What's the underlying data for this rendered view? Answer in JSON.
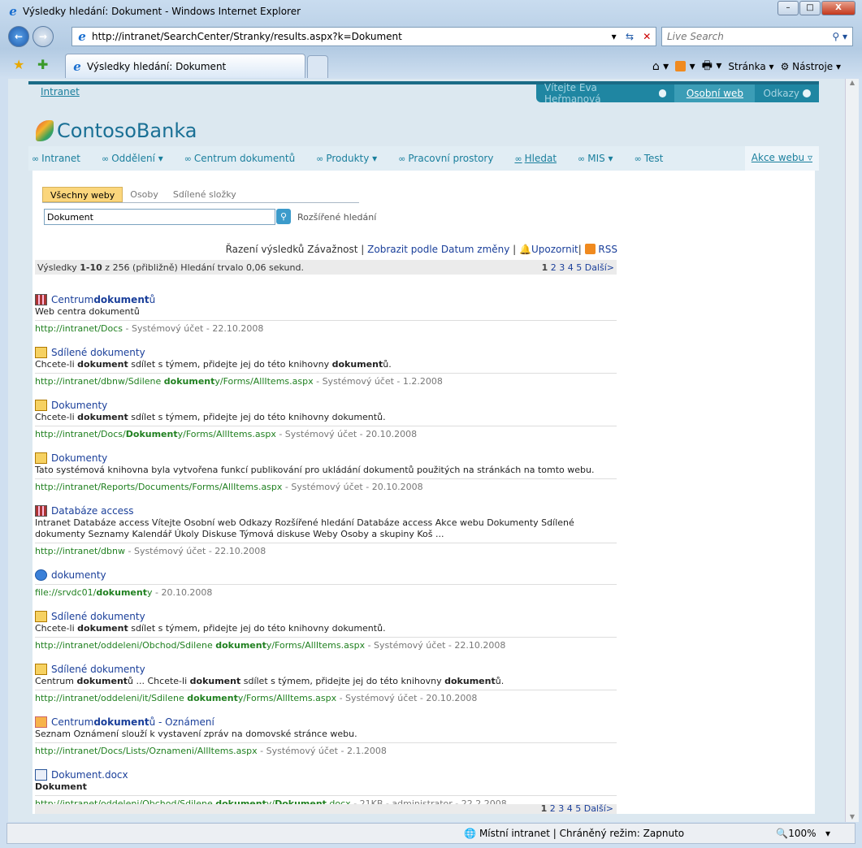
{
  "window": {
    "title": "Výsledky hledání: Dokument - Windows Internet Explorer",
    "minimize": "–",
    "maximize": "□",
    "close": "X"
  },
  "browser": {
    "url": "http://intranet/SearchCenter/Stranky/results.aspx?k=Dokument",
    "search_placeholder": "Live Search",
    "tab_title": "Výsledky hledání: Dokument",
    "page_menu": "Stránka",
    "tools_menu": "Nástroje"
  },
  "status": {
    "zone": "Místní intranet | Chráněný režim: Zapnuto",
    "zoom": "100%"
  },
  "site": {
    "breadcrumb": "Intranet",
    "welcome": "Vítejte Eva Heřmanová",
    "my_site": "Osobní web",
    "links": "Odkazy",
    "logo": "ContosoBanka",
    "nav": [
      "Intranet",
      "Oddělení ▾",
      "Centrum dokumentů",
      "Produkty ▾",
      "Pracovní prostory",
      "Hledat",
      "MIS ▾",
      "Test"
    ],
    "site_actions": "Akce webu ▿"
  },
  "search": {
    "scopes": [
      "Všechny weby",
      "Osoby",
      "Sdílené složky"
    ],
    "query": "Dokument",
    "advanced": "Rozšířené hledání",
    "sort_label": "Řazení výsledků",
    "sort_value": "Závažnost",
    "view_by": "Zobrazit podle Datum změny",
    "alert": "Upozornit",
    "rss": "RSS",
    "summary_pre": "Výsledky ",
    "summary_range": "1-10",
    "summary_post": " z 256 (přibližně) Hledání trvalo 0,06 sekund.",
    "pages": [
      "1",
      "2",
      "3",
      "4",
      "5"
    ],
    "next": "Další>"
  },
  "results": [
    {
      "icon": "site",
      "title": [
        [
          "Centrum ",
          0
        ],
        [
          "dokument",
          1
        ],
        [
          "ů",
          0
        ]
      ],
      "desc": [
        [
          "Web centra dokumentů",
          0
        ]
      ],
      "url": [
        [
          "http://intranet/Docs",
          0
        ]
      ],
      "meta": " - Systémový účet - 22.10.2008"
    },
    {
      "icon": "doclib",
      "title": [
        [
          "Sdílené dokumenty",
          0
        ]
      ],
      "desc": [
        [
          "Chcete-li ",
          0
        ],
        [
          "dokument",
          1
        ],
        [
          " sdílet s týmem, přidejte jej do této knihovny ",
          0
        ],
        [
          "dokument",
          1
        ],
        [
          "ů.",
          0
        ]
      ],
      "url": [
        [
          "http://intranet/dbnw/Sdilene ",
          0
        ],
        [
          "dokument",
          1
        ],
        [
          "y/Forms/AllItems.aspx",
          0
        ]
      ],
      "meta": " - Systémový účet - 1.2.2008"
    },
    {
      "icon": "doclib",
      "title": [
        [
          "Dokumenty",
          0
        ]
      ],
      "desc": [
        [
          "Chcete-li ",
          0
        ],
        [
          "dokument",
          1
        ],
        [
          " sdílet s týmem, přidejte jej do této knihovny dokumentů.",
          0
        ]
      ],
      "url": [
        [
          "http://intranet/Docs/",
          0
        ],
        [
          "Dokument",
          1
        ],
        [
          "y/Forms/AllItems.aspx",
          0
        ]
      ],
      "meta": " - Systémový účet - 20.10.2008"
    },
    {
      "icon": "doclib",
      "title": [
        [
          "Dokumenty",
          0
        ]
      ],
      "desc": [
        [
          "Tato systémová knihovna byla vytvořena funkcí publikování pro ukládání dokumentů použitých na stránkách na tomto webu.",
          0
        ]
      ],
      "url": [
        [
          "http://intranet/Reports/Documents/Forms/AllItems.aspx",
          0
        ]
      ],
      "meta": " - Systémový účet - 20.10.2008"
    },
    {
      "icon": "site",
      "title": [
        [
          "Databáze access",
          0
        ]
      ],
      "desc": [
        [
          "Intranet Databáze access Vítejte Osobní web Odkazy Rozšířené hledání Databáze access Akce webu Dokumenty Sdílené dokumenty Seznamy Kalendář Úkoly Diskuse Týmová diskuse Weby Osoby a skupiny  Koš  ...",
          0
        ]
      ],
      "url": [
        [
          "http://intranet/dbnw",
          0
        ]
      ],
      "meta": " - Systémový účet - 22.10.2008"
    },
    {
      "icon": "ie",
      "title": [
        [
          "dokumenty",
          0
        ]
      ],
      "desc": [],
      "url": [
        [
          "file://srvdc01/",
          0
        ],
        [
          "dokument",
          1
        ],
        [
          "y",
          0
        ]
      ],
      "meta": " - 20.10.2008"
    },
    {
      "icon": "doclib",
      "title": [
        [
          "Sdílené dokumenty",
          0
        ]
      ],
      "desc": [
        [
          "Chcete-li ",
          0
        ],
        [
          "dokument",
          1
        ],
        [
          " sdílet s týmem, přidejte jej do této knihovny dokumentů.",
          0
        ]
      ],
      "url": [
        [
          "http://intranet/oddeleni/Obchod/Sdilene ",
          0
        ],
        [
          "dokument",
          1
        ],
        [
          "y/Forms/AllItems.aspx",
          0
        ]
      ],
      "meta": " - Systémový účet - 22.10.2008"
    },
    {
      "icon": "doclib",
      "title": [
        [
          "Sdílené dokumenty",
          0
        ]
      ],
      "desc": [
        [
          "Centrum ",
          0
        ],
        [
          "dokument",
          1
        ],
        [
          "ů ... Chcete-li ",
          0
        ],
        [
          "dokument",
          1
        ],
        [
          " sdílet s týmem, přidejte jej do této knihovny ",
          0
        ],
        [
          "dokument",
          1
        ],
        [
          "ů.",
          0
        ]
      ],
      "url": [
        [
          "http://intranet/oddeleni/it/Sdilene ",
          0
        ],
        [
          "dokument",
          1
        ],
        [
          "y/Forms/AllItems.aspx",
          0
        ]
      ],
      "meta": " - Systémový účet - 20.10.2008"
    },
    {
      "icon": "list",
      "title": [
        [
          "Centrum ",
          0
        ],
        [
          "dokument",
          1
        ],
        [
          "ů - Oznámení",
          0
        ]
      ],
      "desc": [
        [
          "Seznam Oznámení slouží k vystavení zpráv na domovské stránce webu.",
          0
        ]
      ],
      "url": [
        [
          "http://intranet/Docs/Lists/Oznameni/AllItems.aspx",
          0
        ]
      ],
      "meta": " - Systémový účet - 2.1.2008"
    },
    {
      "icon": "word",
      "title": [
        [
          "Dokument.docx",
          0
        ]
      ],
      "desc": [
        [
          "Dokument",
          1
        ]
      ],
      "url": [
        [
          "http://intranet/oddeleni/Obchod/Sdilene ",
          0
        ],
        [
          "dokument",
          1
        ],
        [
          "y/",
          0
        ],
        [
          "Dokument",
          1
        ],
        [
          ".docx",
          0
        ]
      ],
      "meta": " - 21KB - administrator - 22.2.2008"
    }
  ]
}
